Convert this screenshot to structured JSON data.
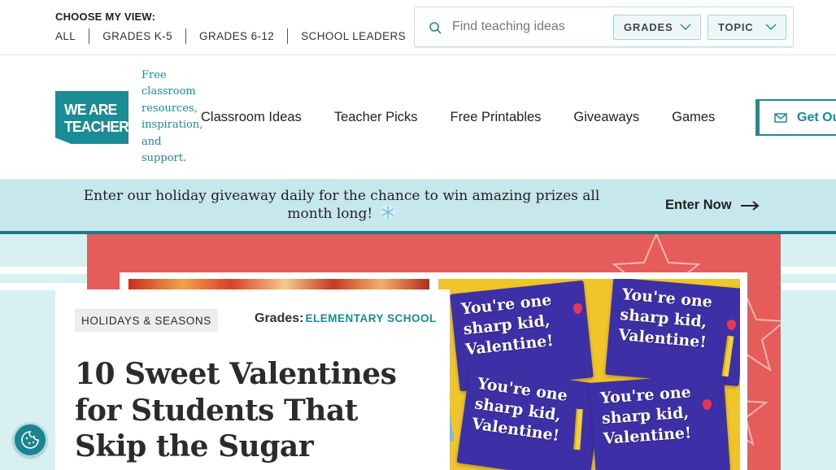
{
  "utility_bar": {
    "choose_label": "CHOOSE MY VIEW:",
    "views": [
      "ALL",
      "GRADES K-5",
      "GRADES 6-12",
      "SCHOOL LEADERS"
    ],
    "search": {
      "placeholder": "Find teaching ideas",
      "value": "",
      "grades_select": "GRADES",
      "topic_select": "TOPIC"
    }
  },
  "header": {
    "logo_line1": "WE ARE",
    "logo_line2": "TEACHERS",
    "tagline": "Free classroom resources, inspiration, and support.",
    "nav": [
      "Classroom Ideas",
      "Teacher Picks",
      "Free Printables",
      "Giveaways",
      "Games"
    ],
    "newsletter_label": "Get Our Newsletters"
  },
  "banner": {
    "text": "Enter our holiday giveaway daily for the chance to win amazing prizes all month long!",
    "cta": "Enter Now"
  },
  "article": {
    "category": "HOLIDAYS & SEASONS",
    "grades_label": "Grades:",
    "grades_value": "ELEMENTARY SCHOOL",
    "title": "10 Sweet Valentines for Students That Skip the Sugar",
    "card_text": "You're one sharp kid, Valentine!"
  },
  "colors": {
    "brand_teal": "#1a8c95",
    "banner_bg": "#c6e8ec",
    "hero_coral": "#e65c5a",
    "card_purple": "#3d2fa5",
    "card_yellow": "#f0c52a"
  },
  "icons": [
    "search-icon",
    "chevron-down-icon",
    "envelope-icon",
    "snowflake-icon",
    "arrow-right-icon",
    "cookie-icon"
  ]
}
